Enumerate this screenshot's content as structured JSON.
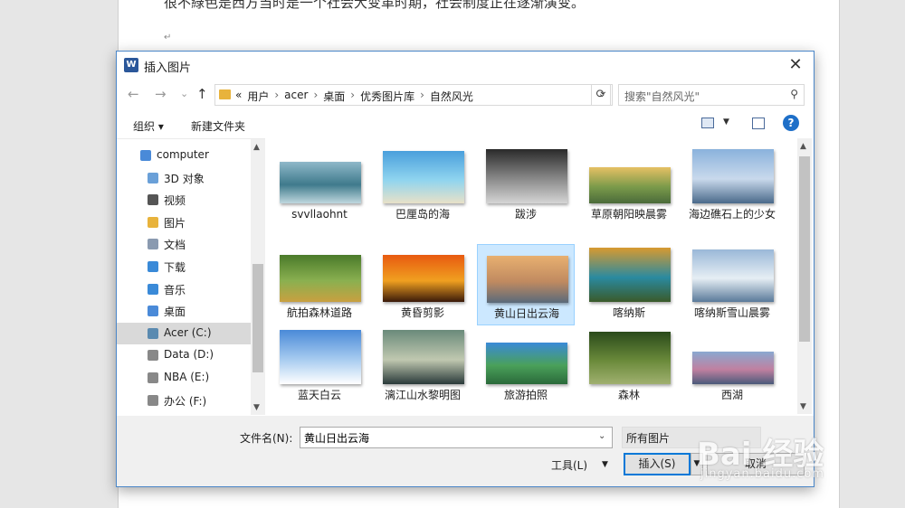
{
  "document": {
    "body_text": "很不綠色是西方当时是一个社会大变革时期，社会制度正在逐渐演变。",
    "paragraph_mark": "↵"
  },
  "dialog": {
    "title": "插入图片",
    "app_icon": "W",
    "close_label": "✕"
  },
  "nav": {
    "back": "←",
    "forward": "→",
    "recent": "⌄",
    "up": "↑",
    "breadcrumbs": [
      "«",
      "用户",
      "acer",
      "桌面",
      "优秀图片库",
      "自然风光"
    ],
    "search_placeholder": "搜索\"自然风光\""
  },
  "toolbar": {
    "organize": "组织 ▾",
    "new_folder": "新建文件夹",
    "help": "?"
  },
  "sidebar": {
    "items": [
      {
        "label": "computer",
        "icon": "computer-icon"
      },
      {
        "label": "3D 对象",
        "icon": "3d-objects-icon"
      },
      {
        "label": "视频",
        "icon": "videos-icon"
      },
      {
        "label": "图片",
        "icon": "pictures-icon"
      },
      {
        "label": "文档",
        "icon": "documents-icon"
      },
      {
        "label": "下载",
        "icon": "downloads-icon"
      },
      {
        "label": "音乐",
        "icon": "music-icon"
      },
      {
        "label": "桌面",
        "icon": "desktop-icon"
      },
      {
        "label": "Acer (C:)",
        "icon": "drive-icon"
      },
      {
        "label": "Data (D:)",
        "icon": "drive-icon"
      },
      {
        "label": "NBA (E:)",
        "icon": "drive-icon"
      },
      {
        "label": "办公 (F:)",
        "icon": "drive-icon"
      }
    ]
  },
  "files": [
    {
      "name": "svvllaohnt",
      "colors": [
        "#8fb8c9",
        "#3f7a8c",
        "#bfd7de"
      ]
    },
    {
      "name": "巴厘岛的海",
      "colors": [
        "#4a9fdc",
        "#8fd4ef",
        "#e8e1c8"
      ]
    },
    {
      "name": "跋涉",
      "colors": [
        "#2a2a2a",
        "#8a8a8a",
        "#d5d5d5"
      ]
    },
    {
      "name": "草原朝阳映晨雾",
      "colors": [
        "#e6c064",
        "#7a9a4a",
        "#4a6a3a"
      ]
    },
    {
      "name": "海边礁石上的少女",
      "colors": [
        "#8ab2dc",
        "#c9d9ec",
        "#4a6a8a"
      ]
    },
    {
      "name": "航拍森林道路",
      "colors": [
        "#4a7a2a",
        "#8ab050",
        "#c9a040"
      ]
    },
    {
      "name": "黄昏剪影",
      "colors": [
        "#e85a10",
        "#f0a020",
        "#3a1a0a"
      ]
    },
    {
      "name": "黄山日出云海",
      "colors": [
        "#e8b070",
        "#c08a60",
        "#5a6a7a"
      ]
    },
    {
      "name": "喀纳斯",
      "colors": [
        "#d89a30",
        "#2a8aa0",
        "#3a5a2a"
      ]
    },
    {
      "name": "喀纳斯雪山晨雾",
      "colors": [
        "#9ab8d8",
        "#e6eef4",
        "#5a7a9a"
      ]
    },
    {
      "name": "蓝天白云",
      "colors": [
        "#4a8ad8",
        "#a8ccf0",
        "#ffffff"
      ]
    },
    {
      "name": "漓江山水黎明图",
      "colors": [
        "#6a8a7a",
        "#c0c8b0",
        "#2a3a3a"
      ]
    },
    {
      "name": "旅游拍照",
      "colors": [
        "#3a8ad8",
        "#4aa05a",
        "#2a6a3a"
      ]
    },
    {
      "name": "森林",
      "colors": [
        "#2a4a1a",
        "#6a8a3a",
        "#a0b070"
      ]
    },
    {
      "name": "西湖",
      "colors": [
        "#8aa8d0",
        "#c080a0",
        "#4a5a7a"
      ]
    }
  ],
  "selected_file": "黄山日出云海",
  "footer": {
    "filename_label": "文件名(N):",
    "filename_value": "黄山日出云海",
    "filetype": "所有图片",
    "tools": "工具(L)",
    "insert": "插入(S)",
    "cancel": "取消"
  },
  "watermark": {
    "brand": "Bai 经验",
    "url": "jingyan.baidu.com"
  }
}
